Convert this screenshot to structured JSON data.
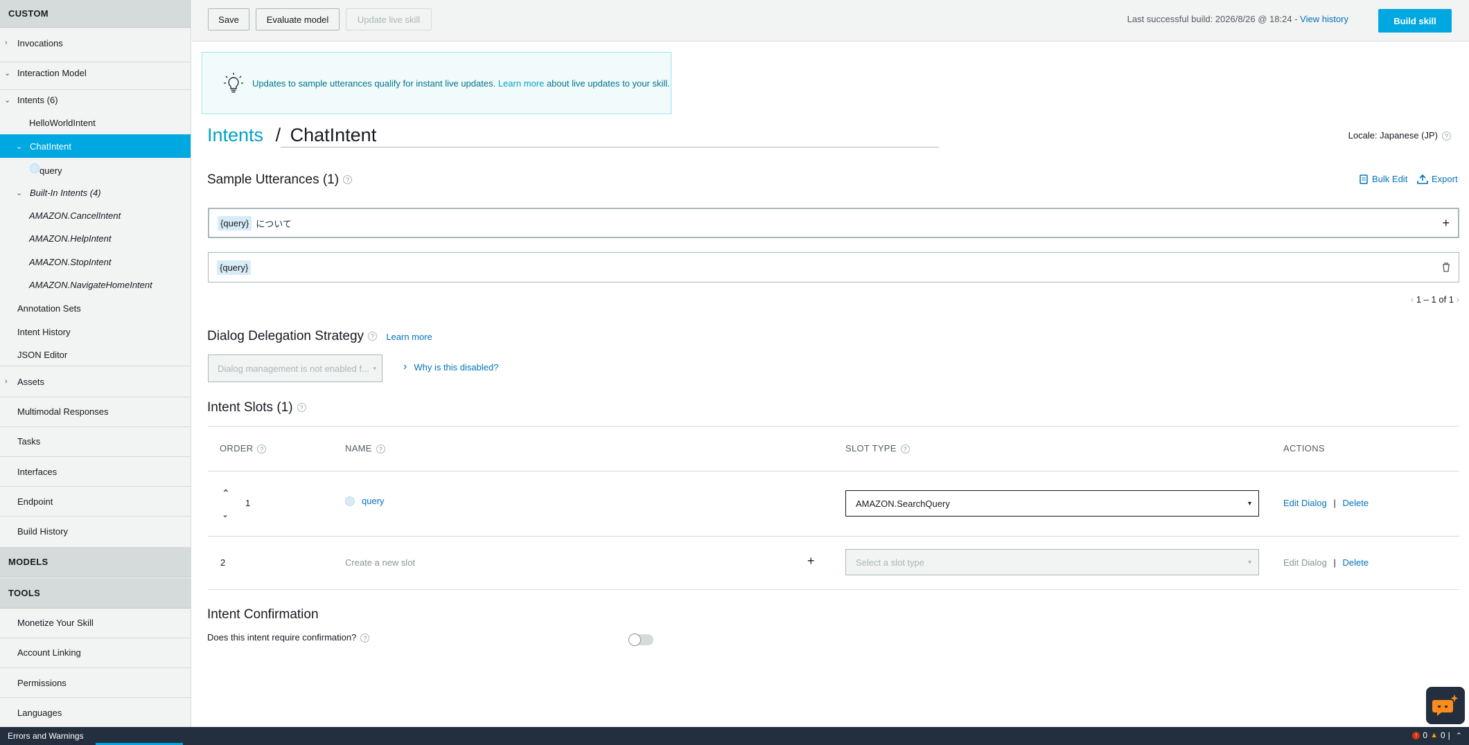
{
  "sidebar": {
    "custom_header": "CUSTOM",
    "invocations": "Invocations",
    "interaction_model": "Interaction Model",
    "intents": "Intents (6)",
    "hello_world": "HelloWorldIntent",
    "chat_intent": "ChatIntent",
    "query_slot": "query",
    "built_in": "Built-In Intents (4)",
    "built_in_items": [
      "AMAZON.CancelIntent",
      "AMAZON.HelpIntent",
      "AMAZON.StopIntent",
      "AMAZON.NavigateHomeIntent"
    ],
    "annotation_sets": "Annotation Sets",
    "intent_history": "Intent History",
    "json_editor": "JSON Editor",
    "assets": "Assets",
    "multimodal": "Multimodal Responses",
    "tasks": "Tasks",
    "interfaces": "Interfaces",
    "endpoint": "Endpoint",
    "build_history": "Build History",
    "models_header": "MODELS",
    "tools_header": "TOOLS",
    "monetize": "Monetize Your Skill",
    "account_linking": "Account Linking",
    "permissions": "Permissions",
    "languages": "Languages"
  },
  "toolbar": {
    "save": "Save",
    "evaluate": "Evaluate model",
    "update_live": "Update live skill",
    "last_build": "Last successful build: 2026/8/26 @ 18:24 -",
    "view_history": "View history",
    "build_skill": "Build skill"
  },
  "banner": {
    "text_before": "Updates to sample utterances qualify for instant live updates.",
    "learn_more": "Learn more",
    "text_after": "about live updates to your skill."
  },
  "title": {
    "intents_link": "Intents",
    "separator": "/",
    "intent_name": "ChatIntent",
    "locale": "Locale: Japanese (JP)"
  },
  "utterances": {
    "heading": "Sample Utterances (1)",
    "bulk_edit": "Bulk Edit",
    "export": "Export",
    "new_slot": "{query}",
    "new_text": "について",
    "existing_slot": "{query}",
    "pagination": "1 – 1 of 1"
  },
  "dialog": {
    "heading": "Dialog Delegation Strategy",
    "learn_more": "Learn more",
    "dropdown_placeholder": "Dialog management is not enabled f...",
    "why_disabled": "Why is this disabled?"
  },
  "slots": {
    "heading": "Intent Slots (1)",
    "col_order": "ORDER",
    "col_name": "NAME",
    "col_slot_type": "SLOT TYPE",
    "col_actions": "ACTIONS",
    "row1_order": "1",
    "row1_name": "query",
    "row1_type": "AMAZON.SearchQuery",
    "row2_order": "2",
    "row2_placeholder": "Create a new slot",
    "row2_type_placeholder": "Select a slot type",
    "edit_dialog": "Edit Dialog",
    "delete": "Delete",
    "divider": "|"
  },
  "confirmation": {
    "heading": "Intent Confirmation",
    "question": "Does this intent require confirmation?",
    "enabled": false
  },
  "statusbar": {
    "label": "Errors and Warnings",
    "errors": "0",
    "warnings": "0",
    "divider": "|"
  },
  "colors": {
    "accent": "#00a8e1",
    "link": "#0073bb",
    "sidebar_bg": "#f2f3f3",
    "status_bg": "#232f3e",
    "chat_orange": "#ff8c1a"
  }
}
